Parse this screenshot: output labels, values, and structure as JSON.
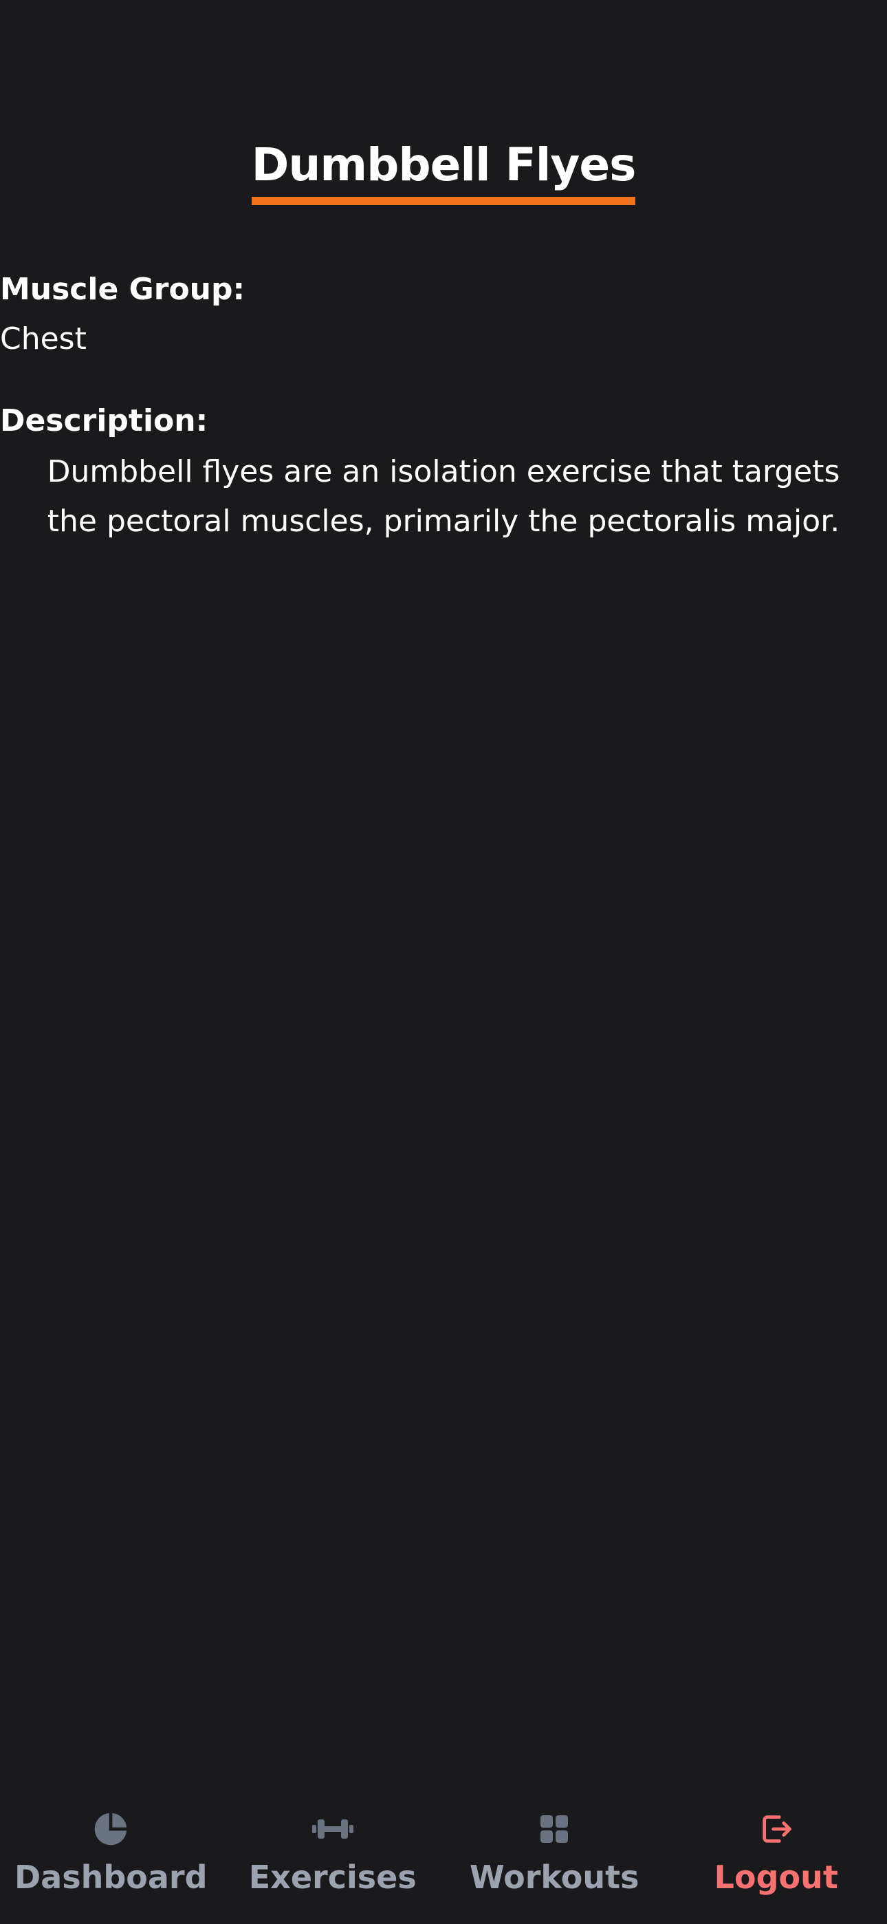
{
  "exercise": {
    "name": "Dumbbell Flyes",
    "muscle_group_label": "Muscle Group:",
    "muscle_group": "Chest",
    "description_label": "Description:",
    "description": "Dumbbell flyes are an isolation exercise that targets the pectoral muscles, primarily the pectoralis major."
  },
  "nav": {
    "items": [
      {
        "label": "Dashboard",
        "icon": "pie-chart-icon"
      },
      {
        "label": "Exercises",
        "icon": "dumbbell-icon"
      },
      {
        "label": "Workouts",
        "icon": "grid-icon"
      },
      {
        "label": "Logout",
        "icon": "logout-icon"
      }
    ]
  },
  "colors": {
    "background": "#1a1a1c",
    "accent": "#f2711c",
    "nav_inactive": "#9ca3af",
    "nav_icon_inactive": "#6b7280",
    "logout": "#f87171"
  }
}
